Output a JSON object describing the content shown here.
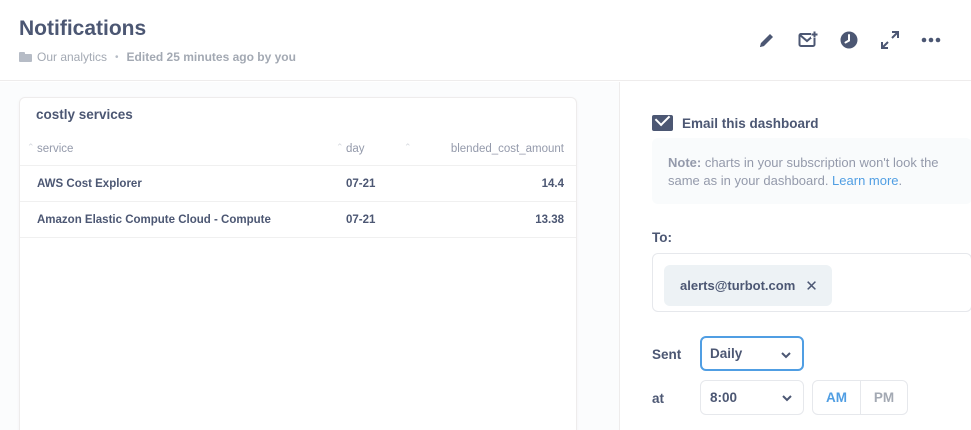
{
  "header": {
    "title": "Notifications",
    "collection": "Our analytics",
    "separator": "•",
    "edited": "Edited 25 minutes ago by you",
    "tools": [
      "pencil-icon",
      "email-plus-icon",
      "clock-icon",
      "fullscreen-icon",
      "more-icon"
    ]
  },
  "card": {
    "title": "costly services",
    "columns": [
      "service",
      "day",
      "blended_cost_amount"
    ],
    "rows": [
      [
        "AWS Cost Explorer",
        "07-21",
        "14.4"
      ],
      [
        "Amazon Elastic Compute Cloud - Compute",
        "07-21",
        "13.38"
      ]
    ]
  },
  "sidebar": {
    "heading": "Email this dashboard",
    "note_bold": "Note:",
    "note_text": " charts in your subscription won't look the same as in your dashboard. ",
    "note_link": "Learn more",
    "note_end": ".",
    "to_label": "To:",
    "recipient": "alerts@turbot.com",
    "remove_glyph": "✕",
    "sent_label": "Sent",
    "frequency": "Daily",
    "at_label": "at",
    "time": "8:00",
    "am": "AM",
    "pm": "PM",
    "selected_period": "AM"
  },
  "colors": {
    "text": "#4c5773",
    "muted": "#949aab",
    "accent": "#509ee3",
    "border": "#eeecec"
  }
}
